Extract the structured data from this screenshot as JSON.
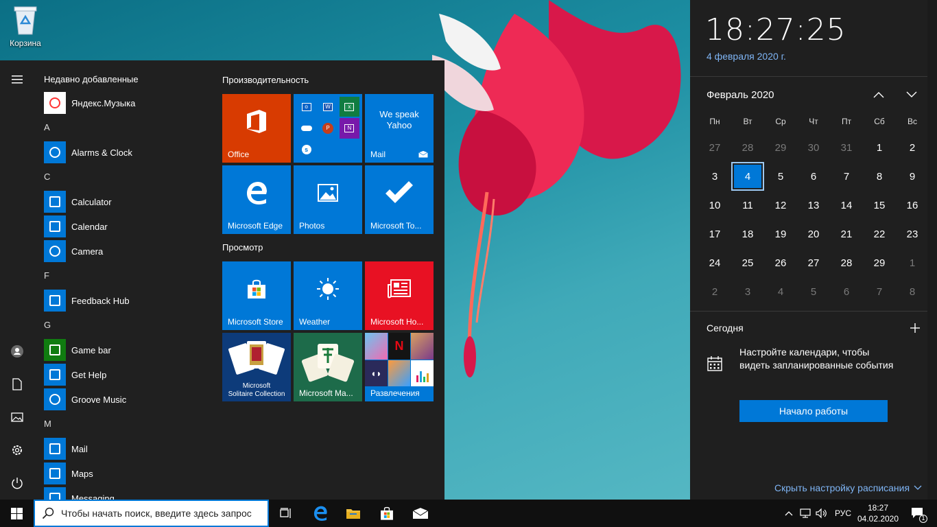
{
  "desktop": {
    "recycle_bin_label": "Корзина"
  },
  "start_menu": {
    "recently_added_header": "Недавно добавленные",
    "apps": [
      {
        "type": "app",
        "label": "Яндекс.Музыка",
        "icon": "yandex-music-icon",
        "color": "#ffffff"
      },
      {
        "type": "letter",
        "label": "A"
      },
      {
        "type": "app",
        "label": "Alarms & Clock",
        "icon": "alarm-clock-icon",
        "color": "#0078d7"
      },
      {
        "type": "letter",
        "label": "C"
      },
      {
        "type": "app",
        "label": "Calculator",
        "icon": "calculator-icon",
        "color": "#0078d7"
      },
      {
        "type": "app",
        "label": "Calendar",
        "icon": "calendar-icon",
        "color": "#0078d7"
      },
      {
        "type": "app",
        "label": "Camera",
        "icon": "camera-icon",
        "color": "#0078d7"
      },
      {
        "type": "letter",
        "label": "F"
      },
      {
        "type": "app",
        "label": "Feedback Hub",
        "icon": "feedback-icon",
        "color": "#0078d7"
      },
      {
        "type": "letter",
        "label": "G"
      },
      {
        "type": "app",
        "label": "Game bar",
        "icon": "xbox-game-bar-icon",
        "color": "#107c10"
      },
      {
        "type": "app",
        "label": "Get Help",
        "icon": "help-icon",
        "color": "#0078d7"
      },
      {
        "type": "app",
        "label": "Groove Music",
        "icon": "groove-music-icon",
        "color": "#0078d7"
      },
      {
        "type": "letter",
        "label": "M"
      },
      {
        "type": "app",
        "label": "Mail",
        "icon": "mail-icon",
        "color": "#0078d7"
      },
      {
        "type": "app",
        "label": "Maps",
        "icon": "maps-icon",
        "color": "#0078d7"
      },
      {
        "type": "app",
        "label": "Messaging",
        "icon": "messaging-icon",
        "color": "#0078d7"
      }
    ],
    "groups": [
      {
        "title": "Производительность"
      },
      {
        "title": "Просмотр"
      }
    ],
    "tiles": {
      "office": "Office",
      "yahoo_line1": "We speak",
      "yahoo_line2": "Yahoo",
      "mail": "Mail",
      "edge": "Microsoft Edge",
      "photos": "Photos",
      "todo": "Microsoft To...",
      "store": "Microsoft Store",
      "weather": "Weather",
      "news": "Microsoft Ho...",
      "solitaire_line1": "Microsoft",
      "solitaire_line2": "Solitaire Collection",
      "mahjong": "Microsoft Ma...",
      "entertainment": "Развлечения"
    },
    "colors": {
      "office": "#d83b01",
      "blue": "#0078d7",
      "red": "#e81123"
    }
  },
  "taskbar": {
    "search_placeholder": "Чтобы начать поиск, введите здесь запрос",
    "language": "РУС",
    "time": "18:27",
    "date": "04.02.2020",
    "notification_count": "1"
  },
  "calendar": {
    "clock": "18:27:25",
    "date_long": "4 февраля 2020 г.",
    "month_title": "Февраль 2020",
    "weekdays": [
      "Пн",
      "Вт",
      "Ср",
      "Чт",
      "Пт",
      "Сб",
      "Вс"
    ],
    "weeks": [
      [
        "27",
        "28",
        "29",
        "30",
        "31",
        "1",
        "2"
      ],
      [
        "3",
        "4",
        "5",
        "6",
        "7",
        "8",
        "9"
      ],
      [
        "10",
        "11",
        "12",
        "13",
        "14",
        "15",
        "16"
      ],
      [
        "17",
        "18",
        "19",
        "20",
        "21",
        "22",
        "23"
      ],
      [
        "24",
        "25",
        "26",
        "27",
        "28",
        "29",
        "1"
      ],
      [
        "2",
        "3",
        "4",
        "5",
        "6",
        "7",
        "8"
      ]
    ],
    "today_label": "Сегодня",
    "agenda_message": "Настройте календари, чтобы видеть запланированные события",
    "get_started_button": "Начало работы",
    "hide_link": "Скрыть настройку расписания"
  }
}
